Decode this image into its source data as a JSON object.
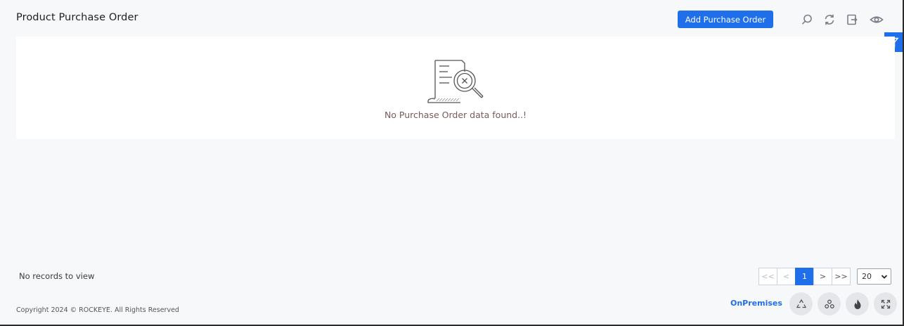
{
  "header": {
    "title": "Product Purchase Order",
    "add_button_label": "Add Purchase Order",
    "tools": [
      "search-icon",
      "refresh-icon",
      "export-icon",
      "view-icon"
    ]
  },
  "filter": {
    "icon": "filter-icon"
  },
  "empty_state": {
    "icon": "no-data-search-icon",
    "message": "No Purchase Order data found..!"
  },
  "footer": {
    "records_text": "No records to view",
    "pagination": {
      "first": "<<",
      "prev": "<",
      "current_page": "1",
      "next": ">",
      "last": ">>"
    },
    "page_size": "20",
    "copyright": "Copyright 2024 © ROCKEYE. All Rights Reserved",
    "environment_label": "OnPremises",
    "action_icons": [
      "recycle-icon",
      "cluster-icon",
      "flame-icon",
      "expand-icon"
    ]
  },
  "colors": {
    "accent": "#1f6feb",
    "background": "#f7f8fa",
    "panel": "#ffffff"
  }
}
